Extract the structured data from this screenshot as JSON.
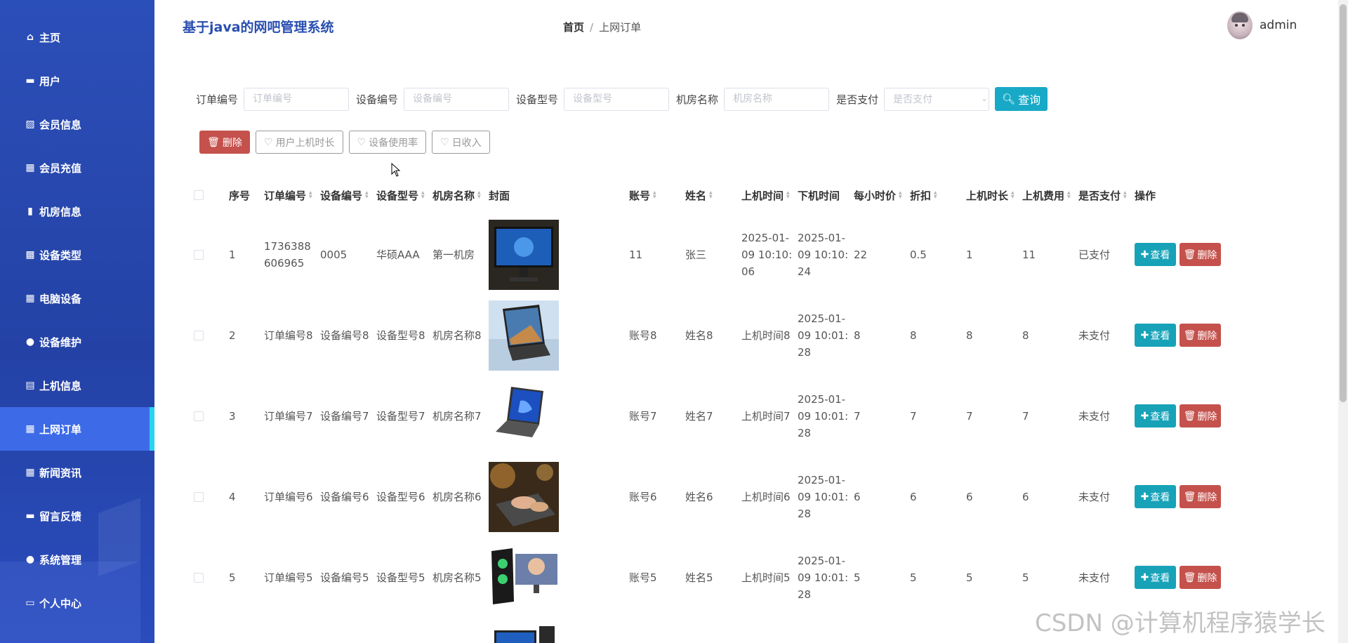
{
  "sidebar": {
    "items": [
      {
        "label": "主页",
        "icon": "home-icon",
        "glyph": "⌂"
      },
      {
        "label": "用户",
        "icon": "id-card-icon",
        "glyph": "▬"
      },
      {
        "label": "会员信息",
        "icon": "chart-icon",
        "glyph": "▨"
      },
      {
        "label": "会员充值",
        "icon": "grid-icon",
        "glyph": "▦"
      },
      {
        "label": "机房信息",
        "icon": "mobile-icon",
        "glyph": "▮"
      },
      {
        "label": "设备类型",
        "icon": "briefcase-icon",
        "glyph": "▩"
      },
      {
        "label": "电脑设备",
        "icon": "grid-icon",
        "glyph": "▦"
      },
      {
        "label": "设备维护",
        "icon": "user-icon",
        "glyph": "●"
      },
      {
        "label": "上机信息",
        "icon": "clipboard-icon",
        "glyph": "▤"
      },
      {
        "label": "上网订单",
        "icon": "grid-icon",
        "glyph": "▦"
      },
      {
        "label": "新闻资讯",
        "icon": "grid-icon",
        "glyph": "▦"
      },
      {
        "label": "留言反馈",
        "icon": "monitor-icon",
        "glyph": "▬"
      },
      {
        "label": "系统管理",
        "icon": "user-icon",
        "glyph": "●"
      },
      {
        "label": "个人中心",
        "icon": "window-icon",
        "glyph": "▭"
      }
    ],
    "active_index": 9
  },
  "header": {
    "title": "基于java的网吧管理系统",
    "breadcrumb_home": "首页",
    "breadcrumb_sep": "/",
    "breadcrumb_current": "上网订单",
    "username": "admin"
  },
  "search": {
    "order_no_label": "订单编号",
    "order_no_placeholder": "订单编号",
    "device_no_label": "设备编号",
    "device_no_placeholder": "设备编号",
    "device_model_label": "设备型号",
    "device_model_placeholder": "设备型号",
    "room_label": "机房名称",
    "room_placeholder": "机房名称",
    "paid_label": "是否支付",
    "paid_placeholder": "是否支付",
    "query_label": "查询"
  },
  "actions": {
    "delete_label": "删除",
    "user_time_label": "用户上机时长",
    "device_usage_label": "设备使用率",
    "daily_income_label": "日收入"
  },
  "table": {
    "headers": {
      "index": "序号",
      "order_no": "订单编号",
      "device_no": "设备编号",
      "device_model": "设备型号",
      "room": "机房名称",
      "cover": "封面",
      "account": "账号",
      "name": "姓名",
      "start": "上机时间",
      "end": "下机时间",
      "hourly": "每小时价",
      "discount": "折扣",
      "duration": "上机时长",
      "fee": "上机费用",
      "paid": "是否支付",
      "ops": "操作"
    },
    "view_label": "查看",
    "delete_label": "删除",
    "rows": [
      {
        "index": "1",
        "order_no": "1736388606965",
        "device_no": "0005",
        "device_model": "华硕AAA",
        "room": "第一机房",
        "account": "11",
        "name": "张三",
        "start": "2025-01-09 10:10:06",
        "end": "2025-01-09 10:10:24",
        "hourly": "22",
        "discount": "0.5",
        "duration": "1",
        "fee": "11",
        "paid": "已支付"
      },
      {
        "index": "2",
        "order_no": "订单编号8",
        "device_no": "设备编号8",
        "device_model": "设备型号8",
        "room": "机房名称8",
        "account": "账号8",
        "name": "姓名8",
        "start": "上机时间8",
        "end": "2025-01-09 10:01:28",
        "hourly": "8",
        "discount": "8",
        "duration": "8",
        "fee": "8",
        "paid": "未支付"
      },
      {
        "index": "3",
        "order_no": "订单编号7",
        "device_no": "设备编号7",
        "device_model": "设备型号7",
        "room": "机房名称7",
        "account": "账号7",
        "name": "姓名7",
        "start": "上机时间7",
        "end": "2025-01-09 10:01:28",
        "hourly": "7",
        "discount": "7",
        "duration": "7",
        "fee": "7",
        "paid": "未支付"
      },
      {
        "index": "4",
        "order_no": "订单编号6",
        "device_no": "设备编号6",
        "device_model": "设备型号6",
        "room": "机房名称6",
        "account": "账号6",
        "name": "姓名6",
        "start": "上机时间6",
        "end": "2025-01-09 10:01:28",
        "hourly": "6",
        "discount": "6",
        "duration": "6",
        "fee": "6",
        "paid": "未支付"
      },
      {
        "index": "5",
        "order_no": "订单编号5",
        "device_no": "设备编号5",
        "device_model": "设备型号5",
        "room": "机房名称5",
        "account": "账号5",
        "name": "姓名5",
        "start": "上机时间5",
        "end": "2025-01-09 10:01:28",
        "hourly": "5",
        "discount": "5",
        "duration": "5",
        "fee": "5",
        "paid": "未支付"
      }
    ]
  },
  "watermark": "CSDN @计算机程序猿学长",
  "colors": {
    "sidebar": "#2b4fb8",
    "active": "#3d6be8",
    "accent_cyan": "#18a9c7",
    "danger": "#c5514c"
  }
}
